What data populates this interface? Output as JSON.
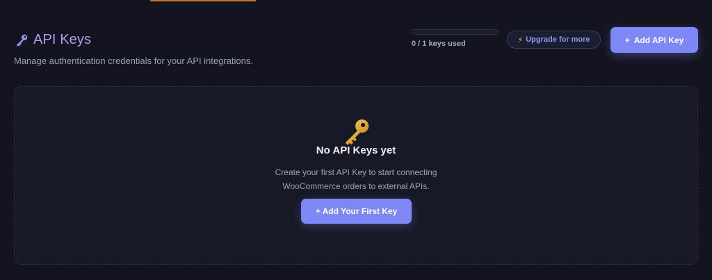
{
  "header": {
    "title": "API Keys",
    "title_icon": "key-icon",
    "subtitle": "Manage authentication credentials for your API integrations."
  },
  "usage": {
    "used": 0,
    "limit": 1,
    "fraction": 0,
    "text": "0 / 1 keys used"
  },
  "upgrade": {
    "icon": "lightning-icon",
    "icon_glyph": "⚡",
    "label": "Upgrade for more"
  },
  "add_button": {
    "plus": "+",
    "label": "Add API Key"
  },
  "empty_state": {
    "icon": "key-icon",
    "title": "No API Keys yet",
    "description_line1": "Create your first API Key to start connecting",
    "description_line2": "WooCommerce orders to external APIs.",
    "button_label": "+ Add Your First Key"
  },
  "colors": {
    "accent": "#7d88f6",
    "title": "#a79ff2",
    "background": "#13141f",
    "card": "#171926",
    "top_accent": "#c8762a"
  }
}
